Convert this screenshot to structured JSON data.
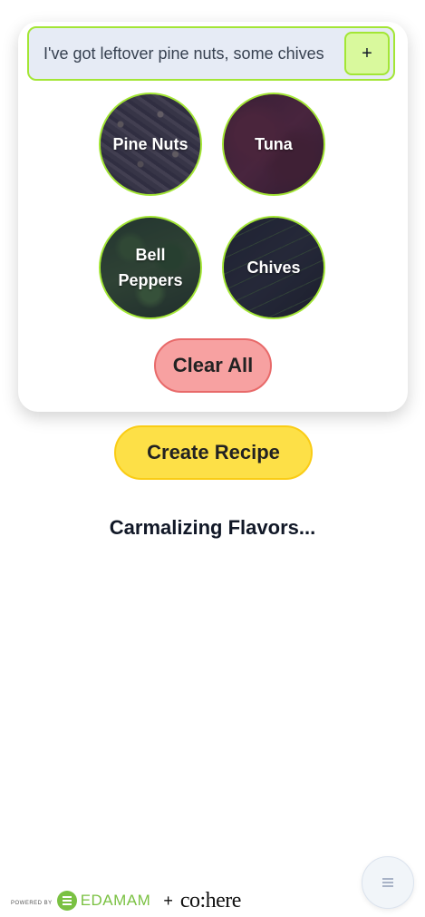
{
  "search": {
    "value": "I've got leftover pine nuts, some chives",
    "add_label": "+"
  },
  "ingredients": [
    {
      "label": "Pine Nuts"
    },
    {
      "label": "Tuna"
    },
    {
      "label": "Bell Peppers"
    },
    {
      "label": "Chives"
    }
  ],
  "actions": {
    "clear_label": "Clear All",
    "create_label": "Create Recipe"
  },
  "status": {
    "text": "Carmalizing Flavors..."
  },
  "footer": {
    "powered_by": "POWERED BY",
    "edamam": "EDAMAM",
    "plus": "+",
    "cohere": "co:here"
  },
  "colors": {
    "accent_green": "#a3e635",
    "clear_red": "#f7a1a1",
    "create_yellow": "#fde047",
    "edamam_green": "#7ac142"
  },
  "icons": {
    "add": "plus-icon",
    "menu": "menu-icon"
  }
}
